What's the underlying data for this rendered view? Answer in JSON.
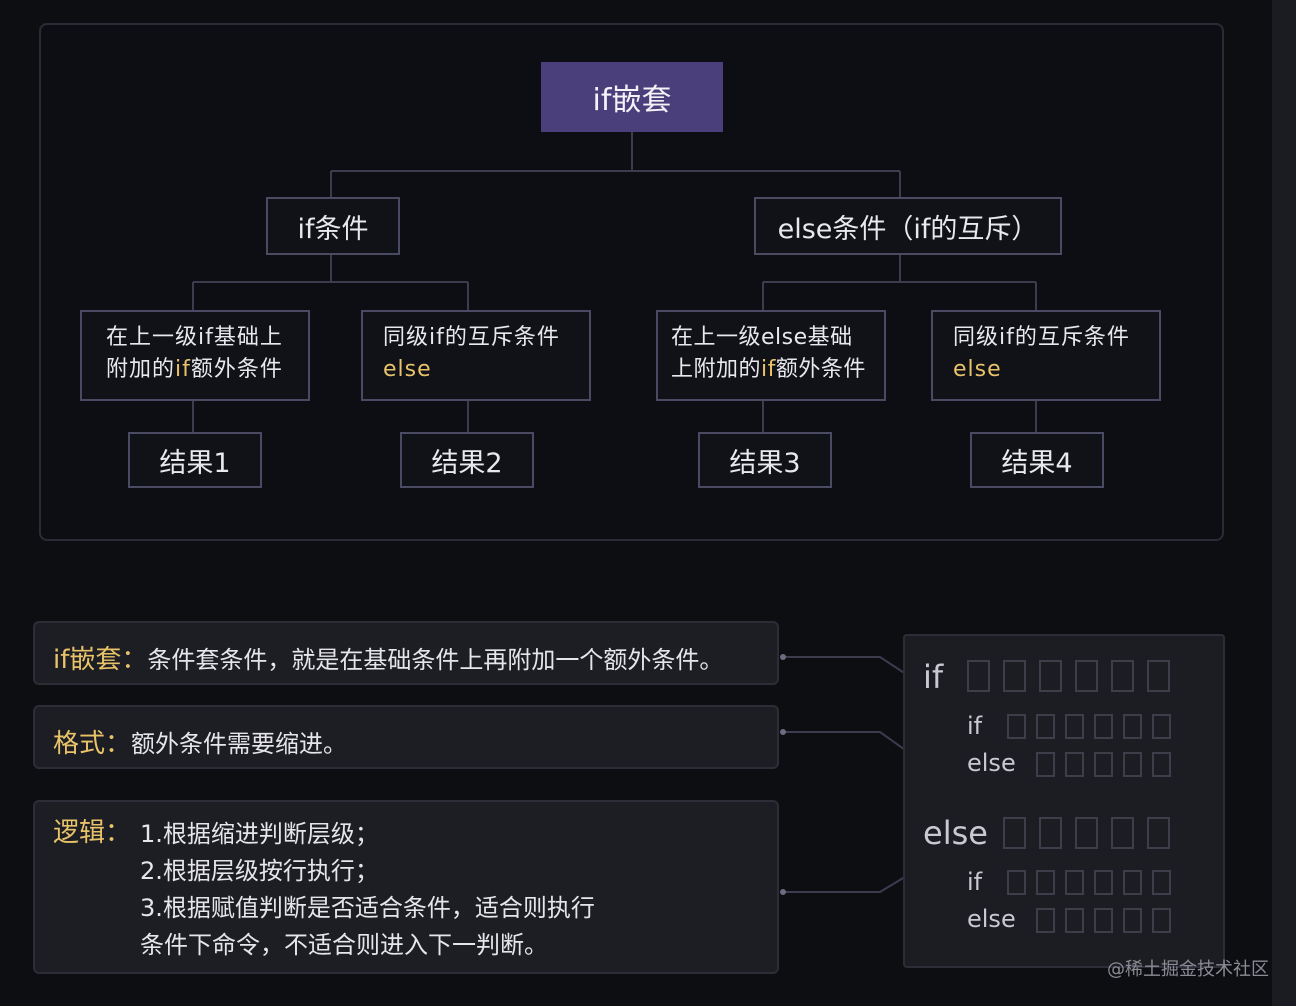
{
  "diagram": {
    "root": "if嵌套",
    "branches": [
      {
        "label": "if条件",
        "children": [
          {
            "line1": "在上一级if基础上",
            "line2_pre": "附加的",
            "line2_hl": "if",
            "line2_post": "额外条件",
            "result": "结果1"
          },
          {
            "line1": "同级if的互斥条件",
            "line2_pre": "",
            "line2_hl": "else",
            "line2_post": "",
            "result": "结果2"
          }
        ]
      },
      {
        "label": "else条件（if的互斥）",
        "children": [
          {
            "line1": "在上一级else基础",
            "line2_pre": "上附加的",
            "line2_hl": "if",
            "line2_post": "额外条件",
            "result": "结果3"
          },
          {
            "line1": "同级if的互斥条件",
            "line2_pre": "",
            "line2_hl": "else",
            "line2_post": "",
            "result": "结果4"
          }
        ]
      }
    ]
  },
  "notes": [
    {
      "key": "if嵌套：",
      "lines": [
        "条件套条件，就是在基础条件上再附加一个额外条件。"
      ]
    },
    {
      "key": "格式：",
      "lines": [
        "额外条件需要缩进。"
      ]
    },
    {
      "key": "逻辑：",
      "lines": [
        "1.根据缩进判断层级；",
        "2.根据层级按行执行；",
        "3.根据赋值判断是否适合条件，适合则执行",
        "条件下命令，不适合则进入下一判断。"
      ]
    }
  ],
  "code_example": {
    "if": "if",
    "inner_if": "if",
    "inner_else": "else",
    "else": "else"
  },
  "watermark": "@稀土掘金技术社区",
  "colors": {
    "accent": "#e9c36a",
    "root_fill": "#4a3f7a",
    "border": "#4a4a63",
    "background": "#0d0e12"
  }
}
